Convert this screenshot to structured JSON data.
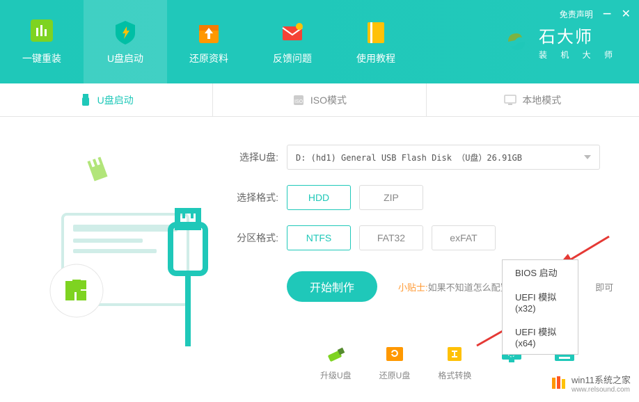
{
  "header": {
    "disclaimer": "免责声明",
    "brand_main": "石大师",
    "brand_sub": "装 机 大 师",
    "nav": [
      {
        "label": "一键重装"
      },
      {
        "label": "U盘启动"
      },
      {
        "label": "还原资料"
      },
      {
        "label": "反馈问题"
      },
      {
        "label": "使用教程"
      }
    ]
  },
  "mode_tabs": [
    {
      "label": "U盘启动"
    },
    {
      "label": "ISO模式"
    },
    {
      "label": "本地模式"
    }
  ],
  "form": {
    "select_udisk_label": "选择U盘:",
    "select_udisk_value": "D: (hd1) General USB Flash Disk （U盘）26.91GB",
    "select_format_label": "选择格式:",
    "format_options": {
      "hdd": "HDD",
      "zip": "ZIP"
    },
    "partition_format_label": "分区格式:",
    "partition_options": {
      "ntfs": "NTFS",
      "fat32": "FAT32",
      "exfat": "exFAT"
    }
  },
  "actions": {
    "start_make": "开始制作",
    "tip_label": "小贴士:",
    "tip_text": "如果不知道怎么配置",
    "tip_suffix": "即可"
  },
  "dropdown": {
    "bios_boot": "BIOS 启动",
    "uefi_x32": "UEFI 模拟(x32)",
    "uefi_x64": "UEFI 模拟(x64)"
  },
  "tools": {
    "upgrade_udisk": "升级U盘",
    "restore_udisk": "还原U盘",
    "format_convert": "格式转换"
  },
  "watermark": {
    "text": "win11系统之家",
    "url": "www.relsound.com"
  }
}
